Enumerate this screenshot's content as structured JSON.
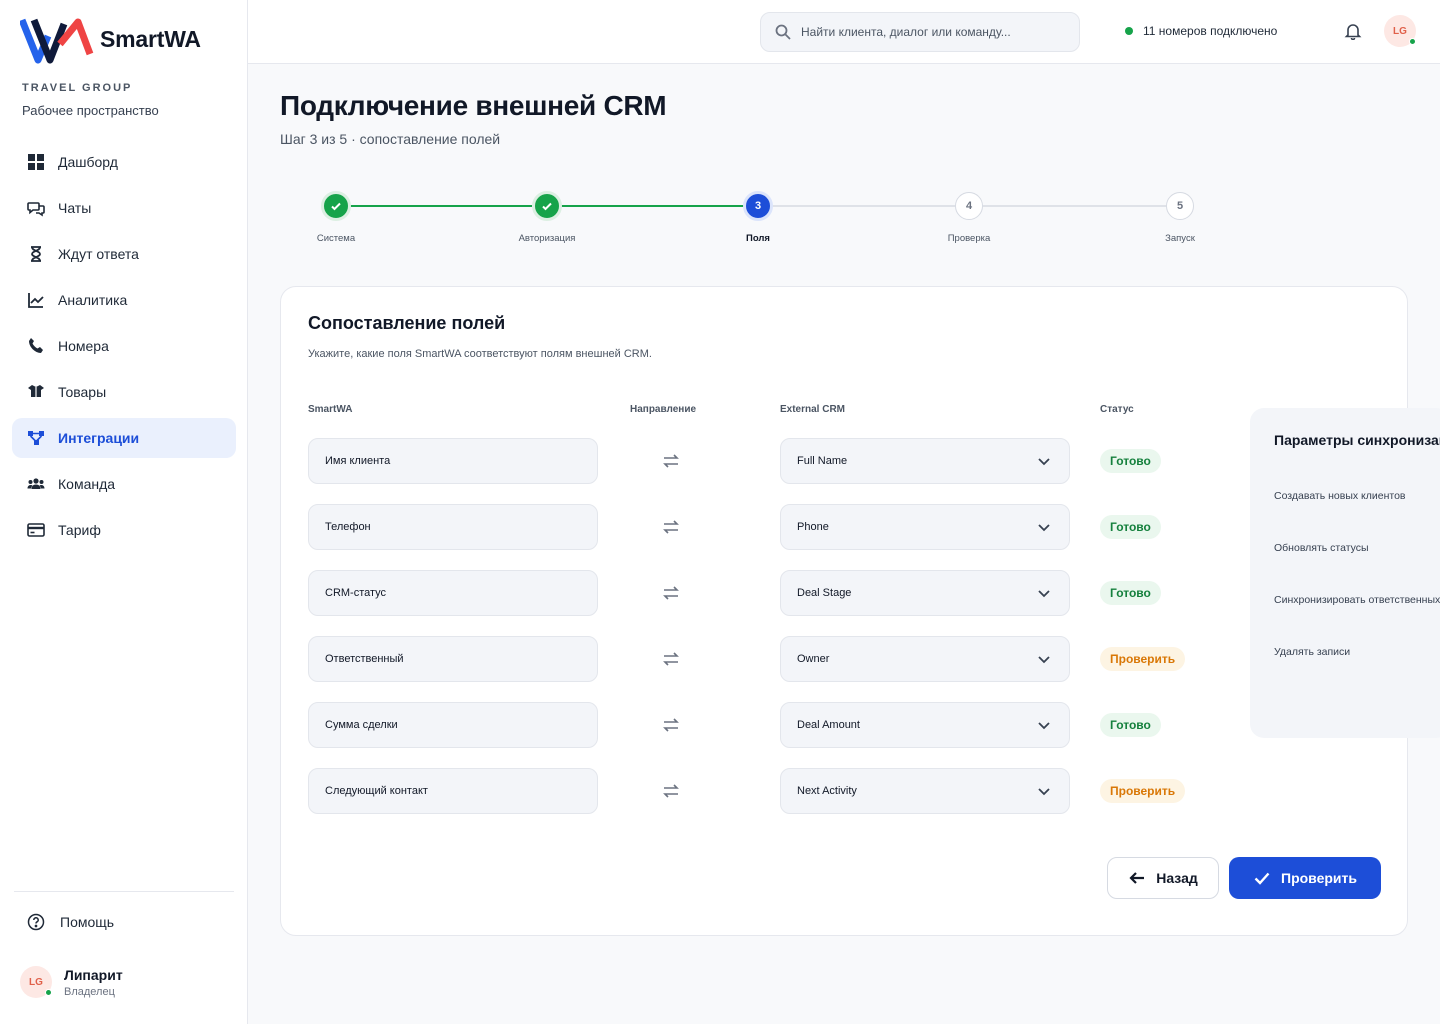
{
  "app": {
    "name": "SmartWA"
  },
  "workspace": {
    "org": "TRAVEL GROUP",
    "label": "Рабочее пространство"
  },
  "sidebar": {
    "items": [
      {
        "label": "Дашборд",
        "icon": "dashboard-icon"
      },
      {
        "label": "Чаты",
        "icon": "chat-icon"
      },
      {
        "label": "Ждут ответа",
        "icon": "hourglass-icon"
      },
      {
        "label": "Аналитика",
        "icon": "analytics-icon"
      },
      {
        "label": "Номера",
        "icon": "phone-icon"
      },
      {
        "label": "Товары",
        "icon": "box-icon"
      },
      {
        "label": "Интеграции",
        "icon": "integrations-icon",
        "active": true
      },
      {
        "label": "Команда",
        "icon": "team-icon"
      },
      {
        "label": "Тариф",
        "icon": "credit-card-icon"
      }
    ],
    "help_label": "Помощь",
    "user": {
      "initials": "LG",
      "name": "Липарит",
      "role": "Владелец"
    }
  },
  "topbar": {
    "search_placeholder": "Найти клиента, диалог или команду...",
    "connection_status": "11 номеров подключено",
    "avatar_initials": "LG"
  },
  "page": {
    "title": "Подключение внешней CRM",
    "subtitle": "Шаг 3 из 5 · сопоставление полей"
  },
  "stepper": {
    "current": 3,
    "steps": [
      {
        "number": "1",
        "label": "Система",
        "state": "done"
      },
      {
        "number": "2",
        "label": "Авторизация",
        "state": "done"
      },
      {
        "number": "3",
        "label": "Поля",
        "state": "current"
      },
      {
        "number": "4",
        "label": "Проверка",
        "state": "todo"
      },
      {
        "number": "5",
        "label": "Запуск",
        "state": "todo"
      }
    ]
  },
  "mapping": {
    "title": "Сопоставление полей",
    "description": "Укажите, какие поля SmartWA соответствуют полям внешней CRM.",
    "columns": {
      "smartwa": "SmartWA",
      "direction": "Направление",
      "external": "External CRM",
      "status": "Статус"
    },
    "rows": [
      {
        "smartwa": "Имя клиента",
        "external": "Full Name",
        "status": "Готово",
        "status_type": "ok"
      },
      {
        "smartwa": "Телефон",
        "external": "Phone",
        "status": "Готово",
        "status_type": "ok"
      },
      {
        "smartwa": "CRM-статус",
        "external": "Deal Stage",
        "status": "Готово",
        "status_type": "ok"
      },
      {
        "smartwa": "Ответственный",
        "external": "Owner",
        "status": "Проверить",
        "status_type": "warn"
      },
      {
        "smartwa": "Сумма сделки",
        "external": "Deal Amount",
        "status": "Готово",
        "status_type": "ok"
      },
      {
        "smartwa": "Следующий контакт",
        "external": "Next Activity",
        "status": "Проверить",
        "status_type": "warn"
      }
    ]
  },
  "sync_panel": {
    "title": "Параметры синхронизации",
    "options": [
      "Создавать новых клиентов",
      "Обновлять статусы",
      "Синхронизировать ответственных",
      "Удалять записи"
    ]
  },
  "actions": {
    "back_label": "Назад",
    "check_label": "Проверить"
  },
  "colors": {
    "accent": "#1d4ed8",
    "success": "#16a34a",
    "warning": "#d97706"
  }
}
